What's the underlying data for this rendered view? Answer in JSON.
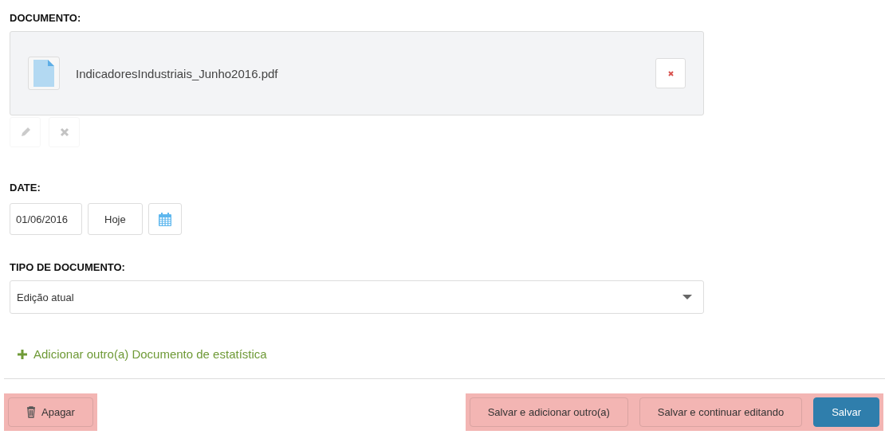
{
  "document": {
    "label": "DOCUMENTO:",
    "file_name": "IndicadoresIndustriais_Junho2016.pdf",
    "edit_disabled": true,
    "delete_disabled": true
  },
  "date": {
    "label": "DATE:",
    "value": "01/06/2016",
    "today_button": "Hoje"
  },
  "document_type": {
    "label": "TIPO DE DOCUMENTO:",
    "value": "Edição atual"
  },
  "add_link": "Adicionar outro(a) Documento de estatística",
  "footer": {
    "left": {
      "highlighted": true,
      "buttons": [
        {
          "label": "Apagar",
          "kind": "delete"
        }
      ]
    },
    "right": {
      "highlighted": true,
      "buttons": [
        {
          "label": "Salvar e adicionar outro(a)",
          "kind": "default"
        },
        {
          "label": "Salvar e continuar editando",
          "kind": "default"
        },
        {
          "label": "Salvar",
          "kind": "primary"
        }
      ]
    }
  }
}
